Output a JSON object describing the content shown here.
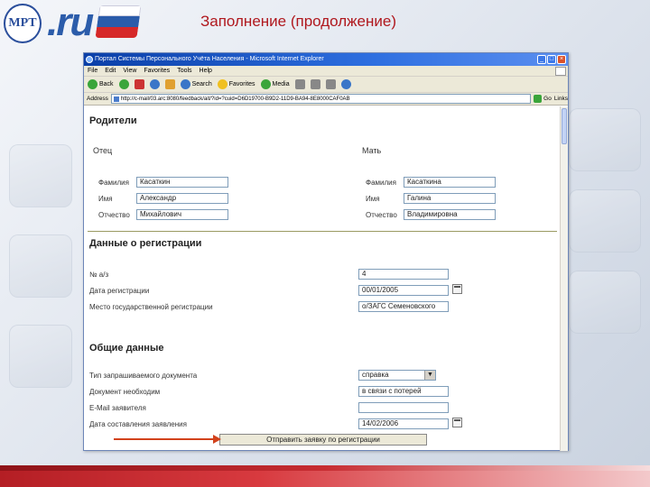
{
  "slide": {
    "title": "Заполнение (продолжение)",
    "logo_left": "МРТ",
    "logo_text": "ru"
  },
  "browser": {
    "window_title": "Портал Системы Персонального Учёта Населения - Microsoft Internet Explorer",
    "menu": [
      "File",
      "Edit",
      "View",
      "Favorites",
      "Tools",
      "Help"
    ],
    "toolbar": {
      "back": "Back",
      "search": "Search",
      "favorites": "Favorites",
      "media": "Media"
    },
    "address_label": "Address",
    "address_value": "http://c-mail/03.arc:8080/feedback/ait/?id=?cuid=D6D19700-B9D2-11D9-BA94-8E8000CAF0AB",
    "go_label": "Go",
    "links_label": "Links"
  },
  "form": {
    "parents": {
      "title": "Родители",
      "father": {
        "title": "Отец",
        "surname_label": "Фамилия",
        "surname": "Касаткин",
        "name_label": "Имя",
        "name": "Александр",
        "patronymic_label": "Отчество",
        "patronymic": "Михайлович"
      },
      "mother": {
        "title": "Мать",
        "surname_label": "Фамилия",
        "surname": "Касаткина",
        "name_label": "Имя",
        "name": "Галина",
        "patronymic_label": "Отчество",
        "patronymic": "Владимировна"
      }
    },
    "registration": {
      "title": "Данные о регистрации",
      "number_label": "№ а/з",
      "number": "4",
      "date_label": "Дата регистрации",
      "date": "00/01/2005",
      "place_label": "Место государственной регистрации",
      "place": "о/ЗАГС Семеновского"
    },
    "general": {
      "title": "Общие данные",
      "doc_type_label": "Тип запрашиваемого документа",
      "doc_type": "справка",
      "doc_reason_label": "Документ необходим",
      "doc_reason": "в связи с потерей",
      "email_label": "E-Mail заявителя",
      "email": "",
      "app_date_label": "Дата составления заявления",
      "app_date": "14/02/2006"
    },
    "submit_label": "Отправить заявку по регистрации"
  }
}
